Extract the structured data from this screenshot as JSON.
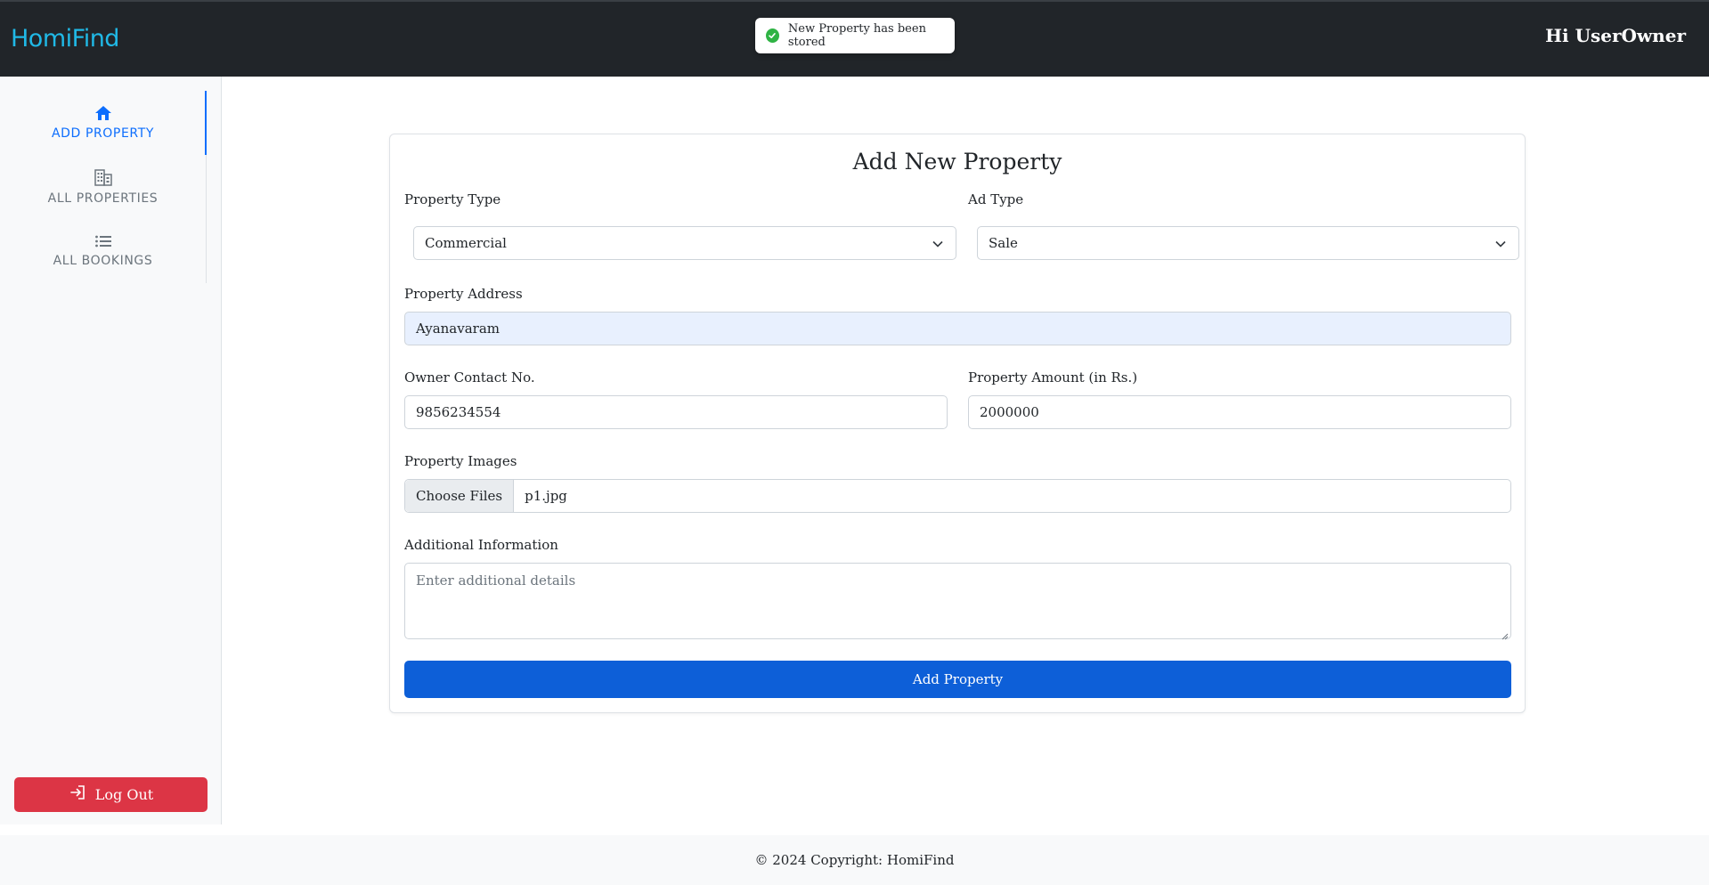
{
  "header": {
    "brand": "HomiFind",
    "greeting": "Hi UserOwner",
    "toast": "New Property has been stored"
  },
  "sidebar": {
    "items": [
      {
        "label": "ADD PROPERTY",
        "icon": "home-icon",
        "active": true
      },
      {
        "label": "ALL PROPERTIES",
        "icon": "building-icon",
        "active": false
      },
      {
        "label": "ALL BOOKINGS",
        "icon": "list-icon",
        "active": false
      }
    ],
    "logout_label": "Log Out"
  },
  "form": {
    "title": "Add New Property",
    "property_type": {
      "label": "Property Type",
      "value": "Commercial"
    },
    "ad_type": {
      "label": "Ad Type",
      "value": "Sale"
    },
    "address": {
      "label": "Property Address",
      "value": "Ayanavaram"
    },
    "contact": {
      "label": "Owner Contact No.",
      "value": "9856234554"
    },
    "amount": {
      "label": "Property Amount (in Rs.)",
      "value": "2000000"
    },
    "images": {
      "label": "Property Images",
      "button": "Choose Files",
      "file": "p1.jpg"
    },
    "additional": {
      "label": "Additional Information",
      "placeholder": "Enter additional details"
    },
    "submit_label": "Add Property"
  },
  "footer": {
    "text": "© 2024 Copyright: HomiFind"
  },
  "colors": {
    "header_bg": "#212529",
    "brand": "#20b9e6",
    "accent": "#0d6efd",
    "danger": "#dc3545",
    "submit": "#0d5fd8",
    "success": "#2fb344"
  }
}
